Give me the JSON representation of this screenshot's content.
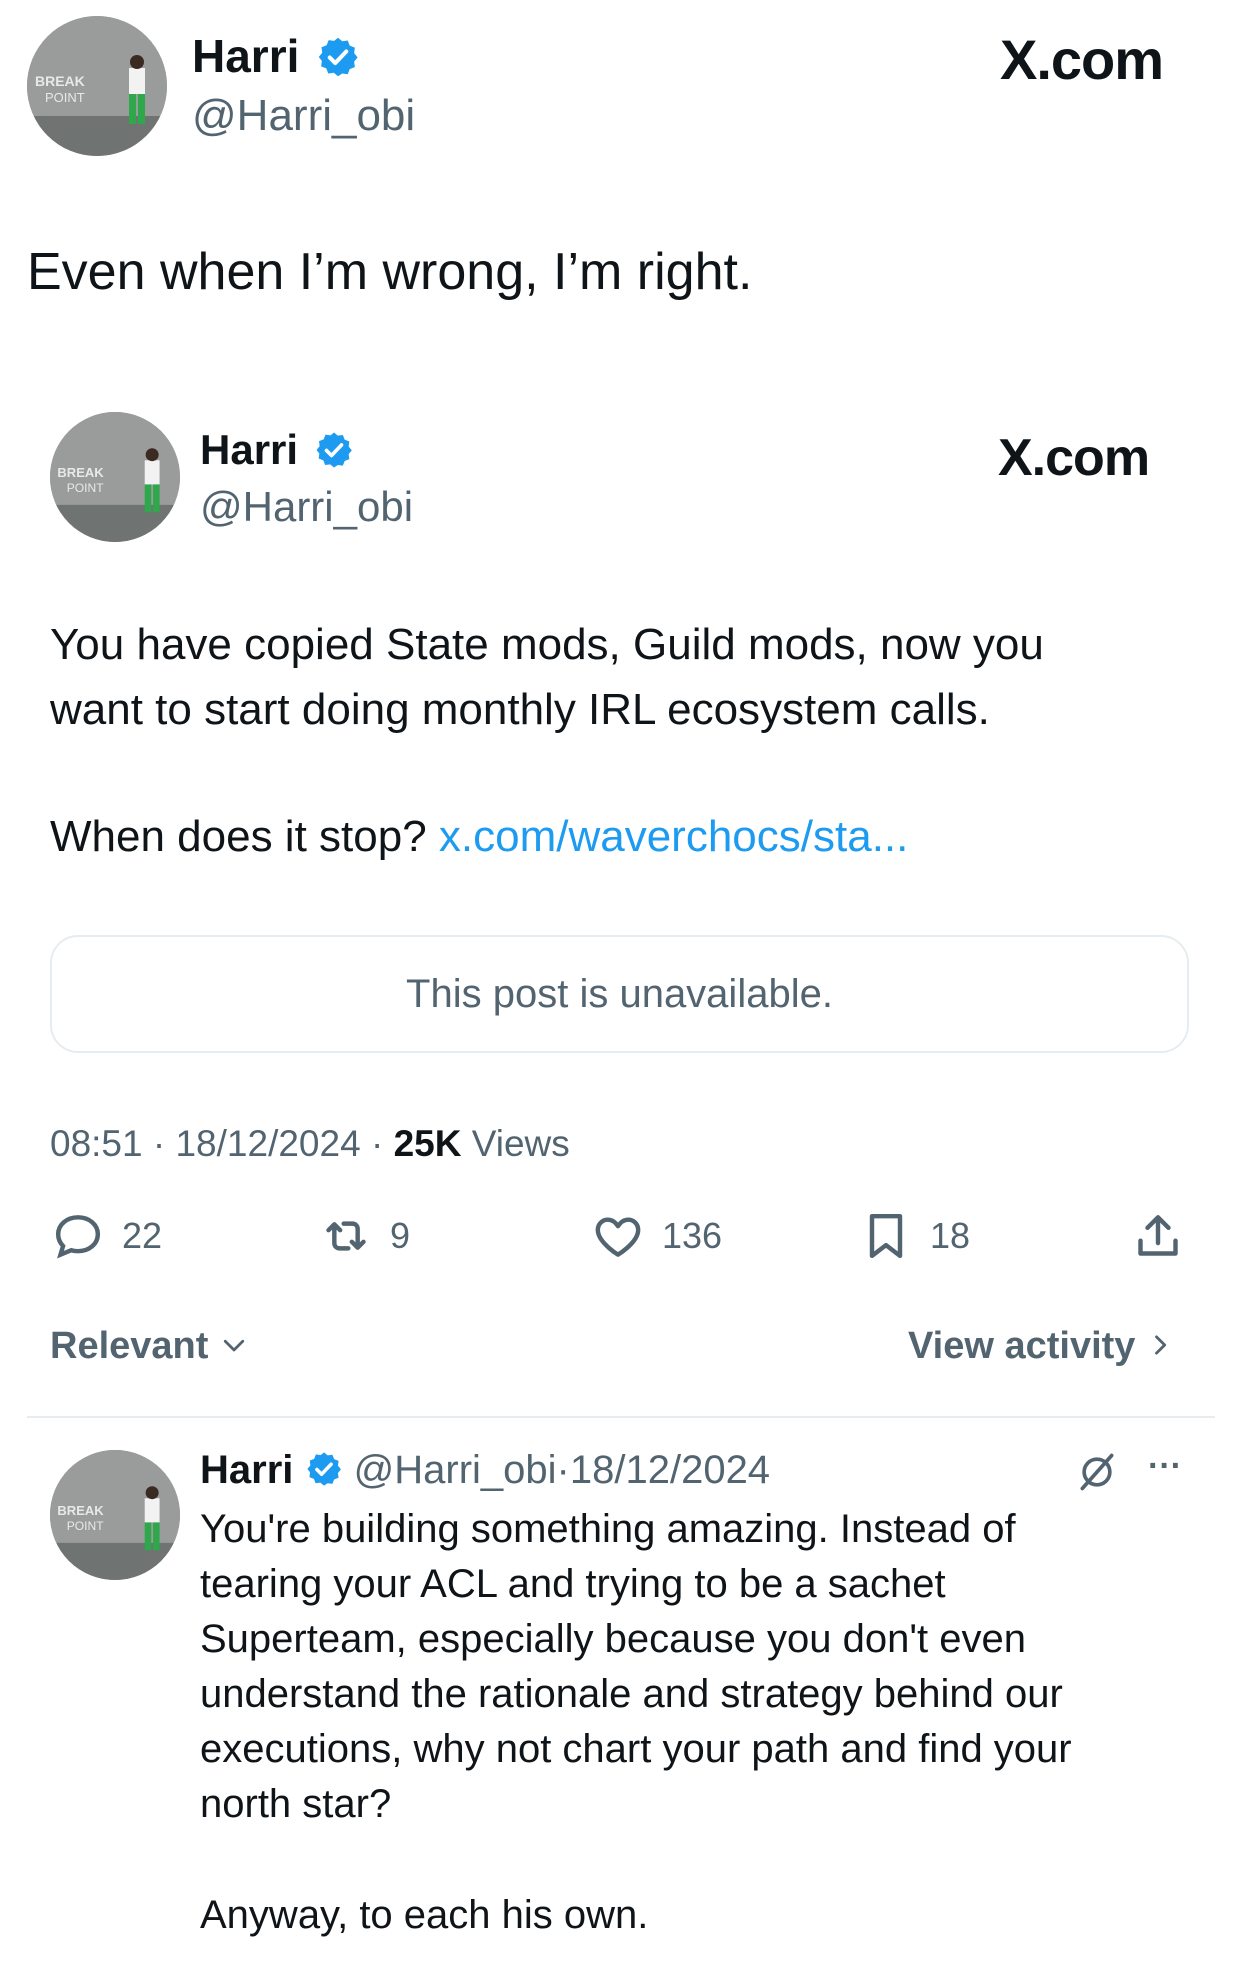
{
  "outer": {
    "name": "Harri",
    "handle": "@Harri_obi",
    "site": "X.com",
    "text": "Even when I’m wrong, I’m right."
  },
  "quoted": {
    "name": "Harri",
    "handle": "@Harri_obi",
    "site": "X.com",
    "text_line1": "You have copied State mods, Guild mods, now you",
    "text_line2": "want to start doing monthly IRL ecosystem calls.",
    "text_q": "When does it stop? ",
    "link": "x.com/waverchocs/sta...",
    "unavailable": "This post is unavailable.",
    "time": "08:51",
    "date": "18/12/2024",
    "views_count": "25K",
    "views_label": "Views",
    "sep": "·"
  },
  "actions": {
    "replies": "22",
    "reposts": "9",
    "likes": "136",
    "bookmarks": "18"
  },
  "sort": {
    "label": "Relevant",
    "activity": "View activity"
  },
  "reply": {
    "name": "Harri",
    "handle": "@Harri_obi",
    "sep": "·",
    "date": "18/12/2024",
    "more": "···",
    "lines": [
      "You're building something amazing. Instead of",
      "tearing your ACL and trying to be a sachet",
      "Superteam, especially because you don't even",
      "understand the rationale and strategy behind our",
      "executions, why not chart your path and find your",
      "north star?"
    ],
    "closing": "Anyway, to each his own."
  },
  "colors": {
    "accent": "#1d9bf0",
    "text": "#0f1419",
    "muted": "#536471"
  },
  "avatar_text": [
    "BREAK",
    "POINT"
  ]
}
